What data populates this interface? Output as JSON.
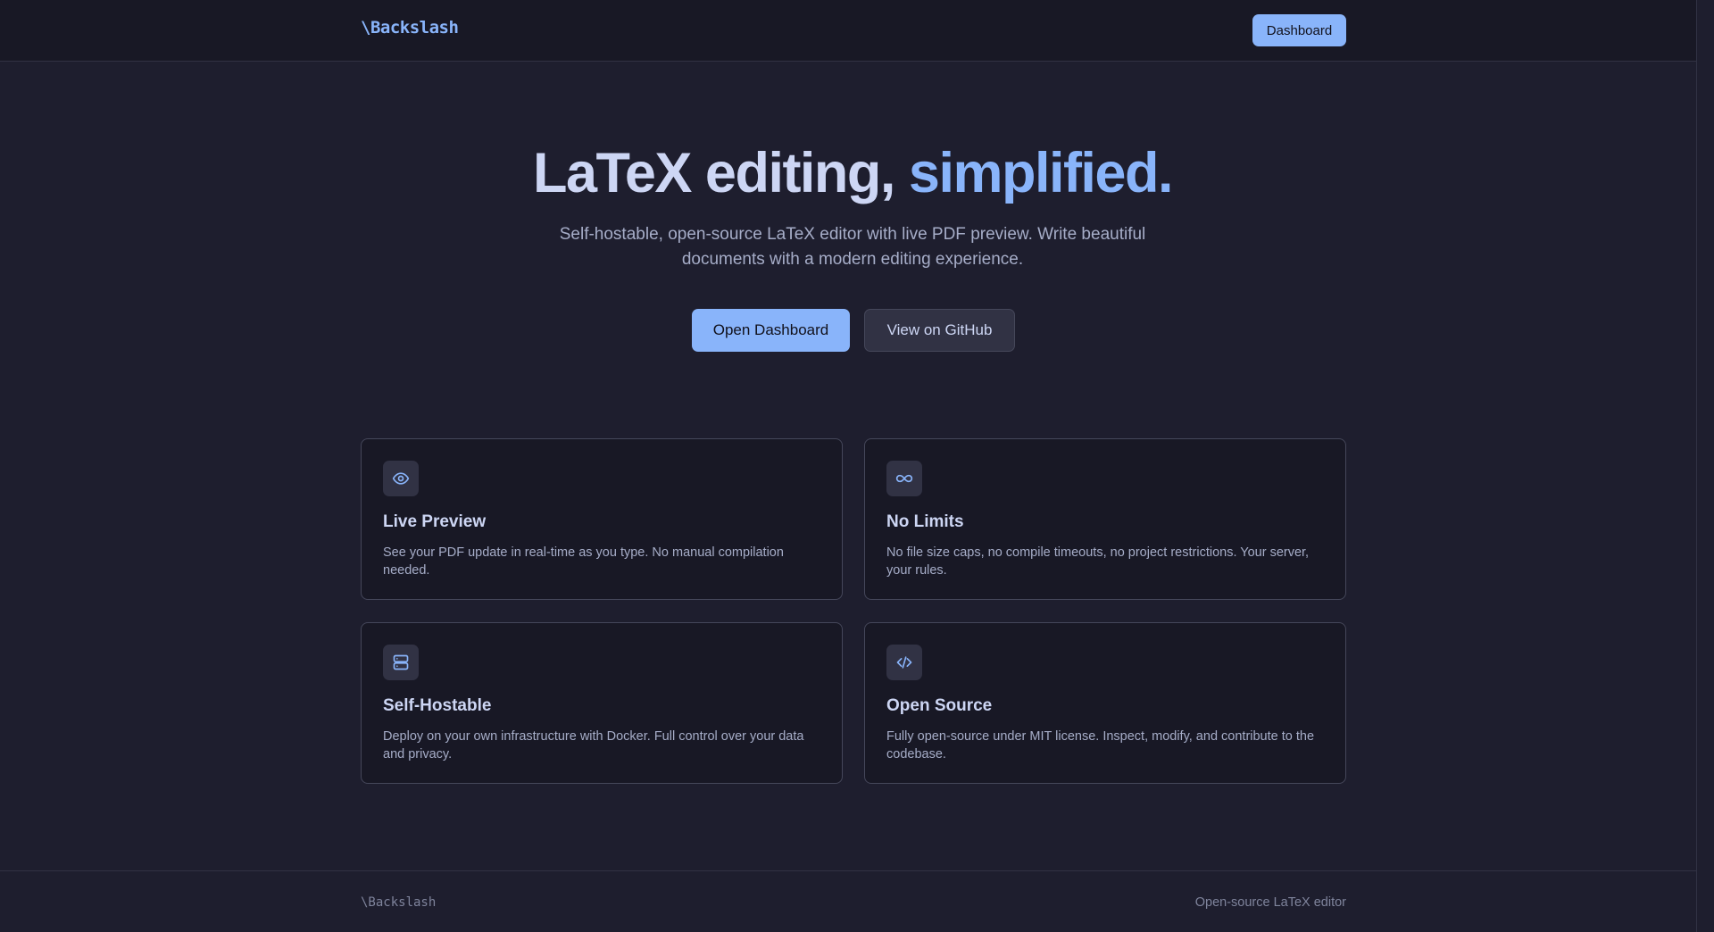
{
  "header": {
    "brand": "\\Backslash",
    "dashboard_button": "Dashboard"
  },
  "hero": {
    "title_main": "LaTeX editing, ",
    "title_accent": "simplified.",
    "subtitle_line1": "Self-hostable, open-source LaTeX editor with live PDF preview. Write beautiful",
    "subtitle_line2": "documents with a modern editing experience.",
    "primary_cta": "Open Dashboard",
    "secondary_cta": "View on GitHub"
  },
  "features": [
    {
      "icon": "eye-icon",
      "title": "Live Preview",
      "description": "See your PDF update in real-time as you type. No manual compilation needed."
    },
    {
      "icon": "infinity-icon",
      "title": "No Limits",
      "description": "No file size caps, no compile timeouts, no project restrictions. Your server, your rules."
    },
    {
      "icon": "server-icon",
      "title": "Self-Hostable",
      "description": "Deploy on your own infrastructure with Docker. Full control over your data and privacy."
    },
    {
      "icon": "code-icon",
      "title": "Open Source",
      "description": "Fully open-source under MIT license. Inspect, modify, and contribute to the codebase."
    }
  ],
  "footer": {
    "brand": "\\Backslash",
    "tagline": "Open-source LaTeX editor"
  },
  "colors": {
    "background": "#1e1e2e",
    "surface": "#181825",
    "accent": "#89b4fa",
    "text": "#cdd6f4",
    "muted_text": "#a6adc8",
    "border": "#45475a"
  }
}
